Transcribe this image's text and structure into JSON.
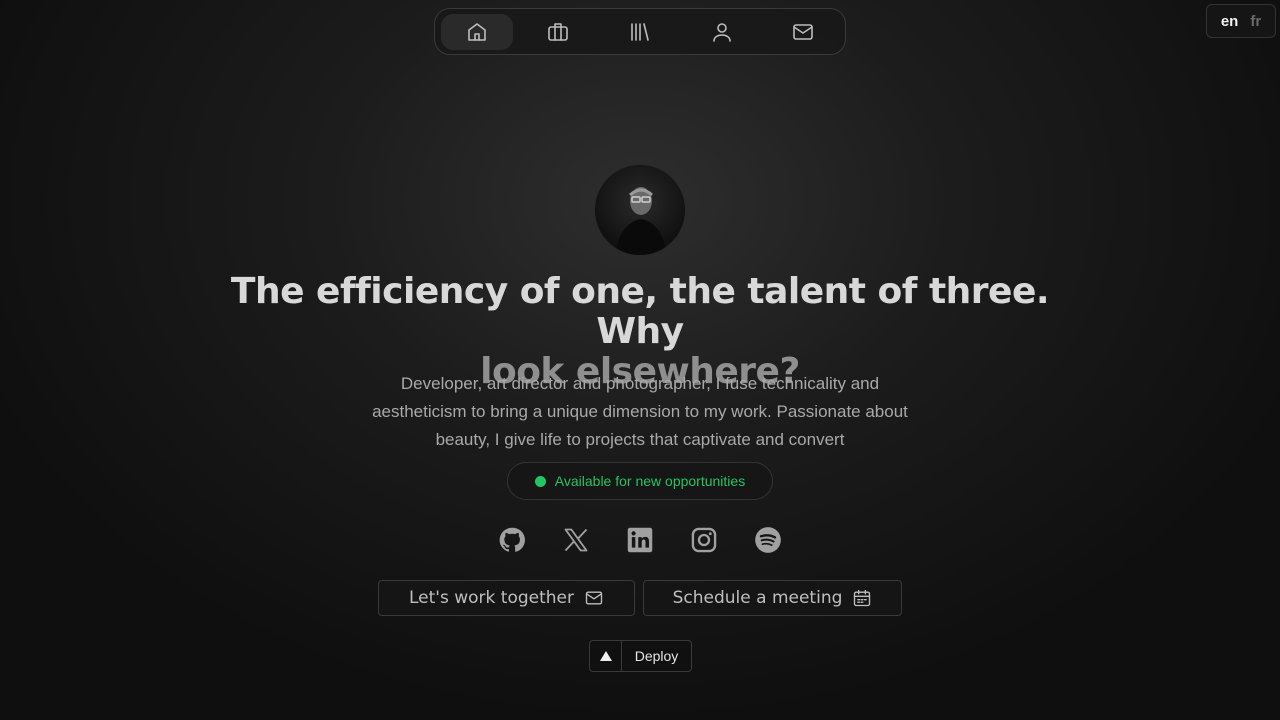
{
  "nav": {
    "items": [
      {
        "icon": "home-icon",
        "active": true
      },
      {
        "icon": "briefcase-icon",
        "active": false
      },
      {
        "icon": "library-icon",
        "active": false
      },
      {
        "icon": "user-icon",
        "active": false
      },
      {
        "icon": "mail-icon",
        "active": false
      }
    ]
  },
  "language": {
    "current": "en",
    "other": "fr"
  },
  "hero": {
    "headline_line1": "The efficiency of one, the talent of three. Why",
    "headline_line2": "look elsewhere?",
    "description": "Developer, art director and photographer, I fuse technicality and aestheticism to bring a unique dimension to my work. Passionate about beauty, I give life to projects that captivate and convert",
    "status": "Available for new opportunities"
  },
  "socials": [
    {
      "icon": "github-icon"
    },
    {
      "icon": "x-icon"
    },
    {
      "icon": "linkedin-icon"
    },
    {
      "icon": "instagram-icon"
    },
    {
      "icon": "spotify-icon"
    }
  ],
  "actions": {
    "work_label": "Let's work together",
    "meeting_label": "Schedule a meeting"
  },
  "deploy": {
    "label": "Deploy"
  },
  "colors": {
    "status_green": "#22c55e",
    "background": "#1c1c1c"
  }
}
